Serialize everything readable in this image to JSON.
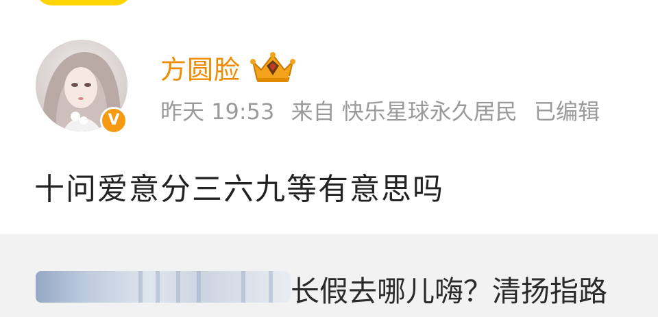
{
  "post": {
    "username": "方圆脸",
    "crown_badge_level": "1",
    "meta": {
      "time": "昨天 19:53",
      "source": "来自 快乐星球永久居民",
      "edited": "已编辑"
    },
    "content": "十问爱意分三六九等有意思吗",
    "verified_symbol": "V"
  },
  "comment": {
    "text": "长假去哪儿嗨？清扬指路"
  },
  "colors": {
    "username": "#f08a00",
    "verified_badge": "#f59a10",
    "meta_text": "#9a9a9a",
    "comment_bg": "#f2f2f2",
    "top_pill": "#ffd400"
  },
  "icons": {
    "crown": "crown-icon",
    "verified": "verified-icon",
    "avatar": "avatar"
  }
}
